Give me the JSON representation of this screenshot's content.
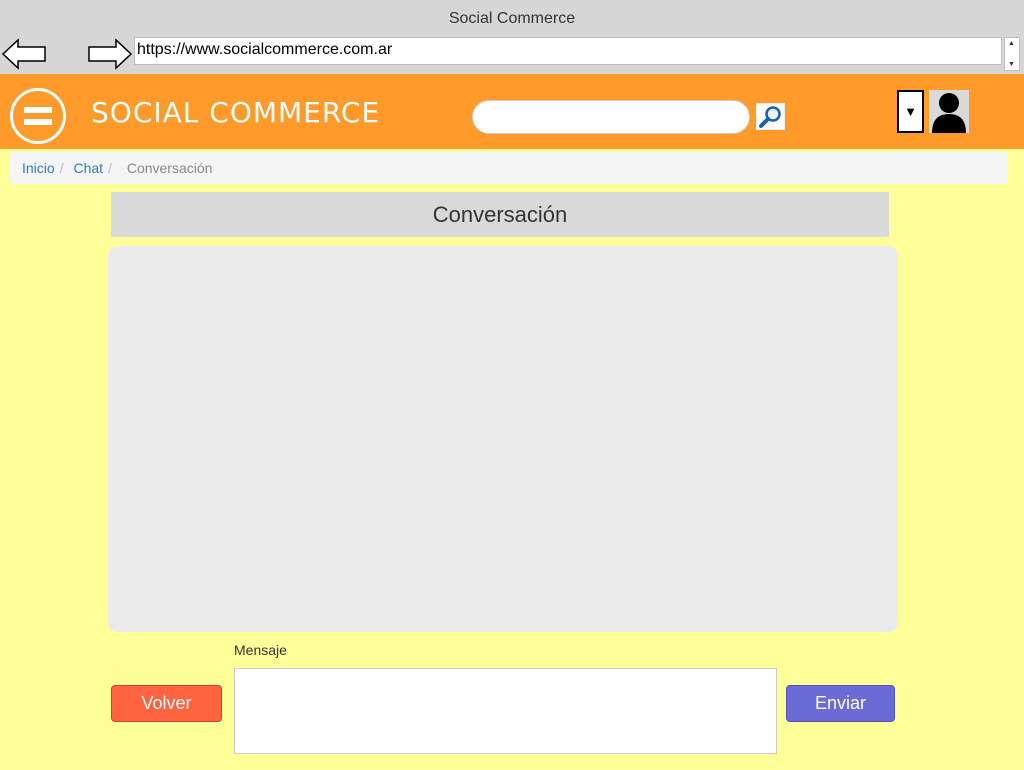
{
  "browser": {
    "window_title": "Social Commerce",
    "url": "https://www.socialcommerce.com.ar"
  },
  "header": {
    "brand": "SOCIAL COMMERCE",
    "search_placeholder": "",
    "user_dropdown_glyph": "▼",
    "icons": {
      "menu": "hamburger-icon",
      "search": "magnifier-icon",
      "user": "user-avatar-icon"
    }
  },
  "breadcrumb": {
    "items": [
      {
        "label": "Inicio"
      },
      {
        "label": "Chat"
      }
    ],
    "separator": "/",
    "current": "Conversación"
  },
  "main": {
    "title": "Conversación",
    "message_label": "Mensaje",
    "message_value": "",
    "back_label": "Volver",
    "send_label": "Enviar"
  },
  "colors": {
    "page_bg": "#ffff99",
    "header_bg": "#ff9a2b",
    "back_button": "#ff6340",
    "send_button": "#6b6bd6",
    "link": "#337ab7"
  }
}
